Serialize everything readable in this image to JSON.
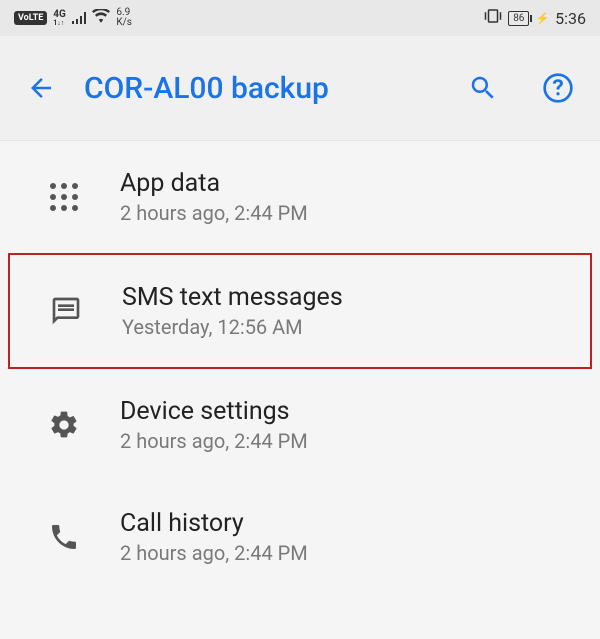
{
  "status_bar": {
    "volte": "VoLTE",
    "net_type": "4G",
    "net_sub": "1↓↑",
    "speed_top": "6.9",
    "speed_bottom": "K/s",
    "battery": "86",
    "time": "5:36"
  },
  "header": {
    "title": "COR-AL00 backup"
  },
  "items": [
    {
      "title": "App data",
      "subtitle": "2 hours ago, 2:44 PM"
    },
    {
      "title": "SMS text messages",
      "subtitle": "Yesterday, 12:56 AM"
    },
    {
      "title": "Device settings",
      "subtitle": "2 hours ago, 2:44 PM"
    },
    {
      "title": "Call history",
      "subtitle": "2 hours ago, 2:44 PM"
    }
  ]
}
